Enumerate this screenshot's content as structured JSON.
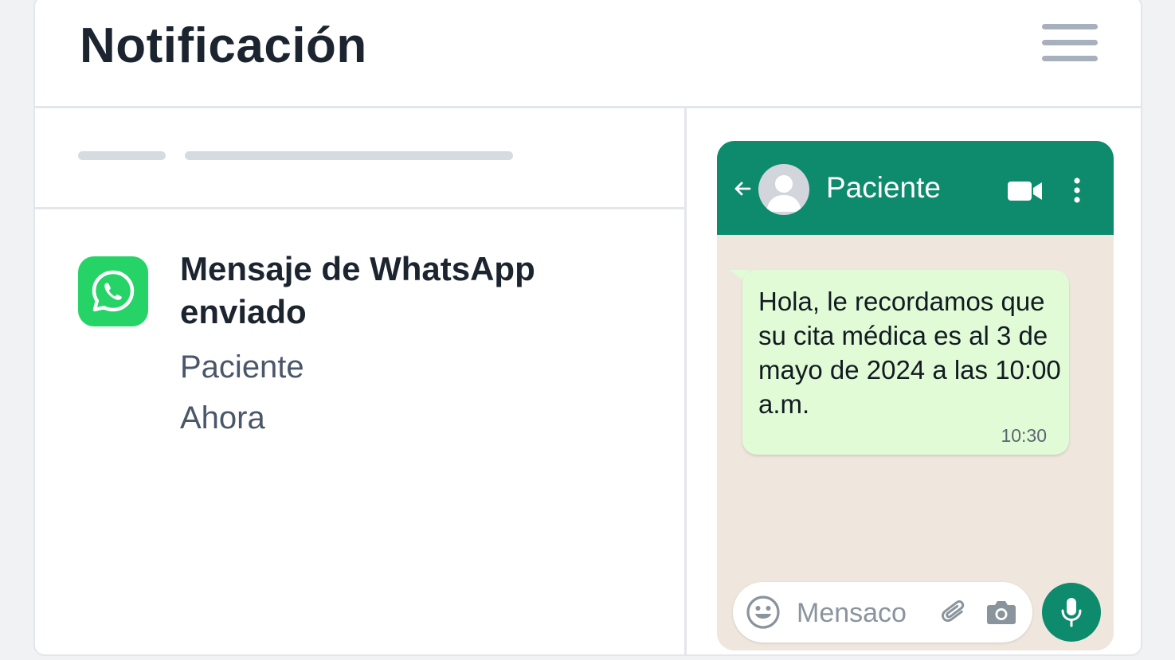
{
  "header": {
    "title": "Notificación",
    "menu_icon": "hamburger-menu-icon"
  },
  "notification": {
    "app_icon": "whatsapp-icon",
    "title": "Mensaje de WhatsApp enviado",
    "recipient": "Paciente",
    "time": "Ahora"
  },
  "chat": {
    "contact_name": "Paciente",
    "message": {
      "text": "Hola, le recordamos que su cita médica es al 3 de mayo de 2024 a las 10:00 a.m.",
      "time": "10:30"
    },
    "input_placeholder": "Mensaco",
    "icons": [
      "back-arrow-icon",
      "avatar-icon",
      "video-call-icon",
      "more-options-icon",
      "emoji-icon",
      "attach-icon",
      "camera-icon",
      "microphone-icon"
    ]
  },
  "colors": {
    "whatsapp_green": "#25d366",
    "header_teal": "#0e8a6d",
    "bubble_green": "#e2fbd7",
    "chat_background": "#efe7dd",
    "title_text": "#1c2430",
    "muted_text": "#4a5669"
  }
}
